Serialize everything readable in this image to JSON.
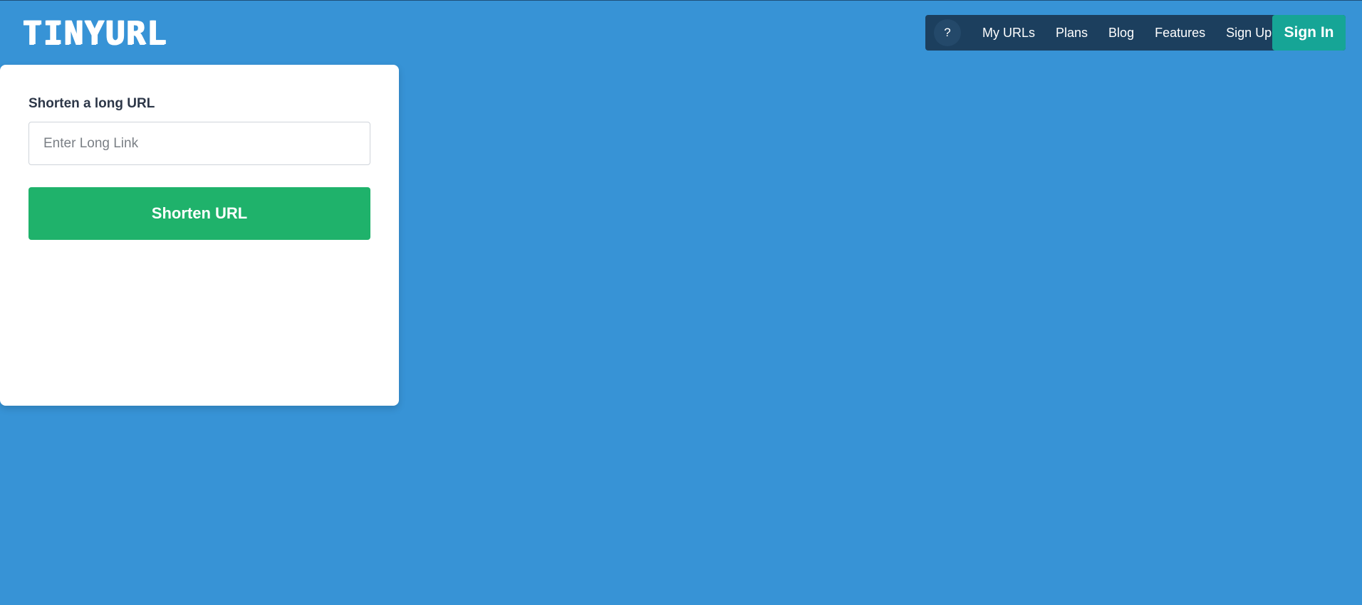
{
  "header": {
    "logo_text": "TINYURL"
  },
  "nav": {
    "help_label": "?",
    "links": [
      {
        "label": "My URLs"
      },
      {
        "label": "Plans"
      },
      {
        "label": "Blog"
      },
      {
        "label": "Features"
      },
      {
        "label": "Sign Up"
      }
    ],
    "signin_label": "Sign In"
  },
  "shortener": {
    "label": "Shorten a long URL",
    "input_placeholder": "Enter Long Link",
    "input_value": "",
    "button_label": "Shorten URL"
  },
  "colors": {
    "background": "#3793d6",
    "nav_background": "#1c3f5e",
    "signin_accent": "#16a596",
    "shorten_button": "#1fb26b"
  }
}
